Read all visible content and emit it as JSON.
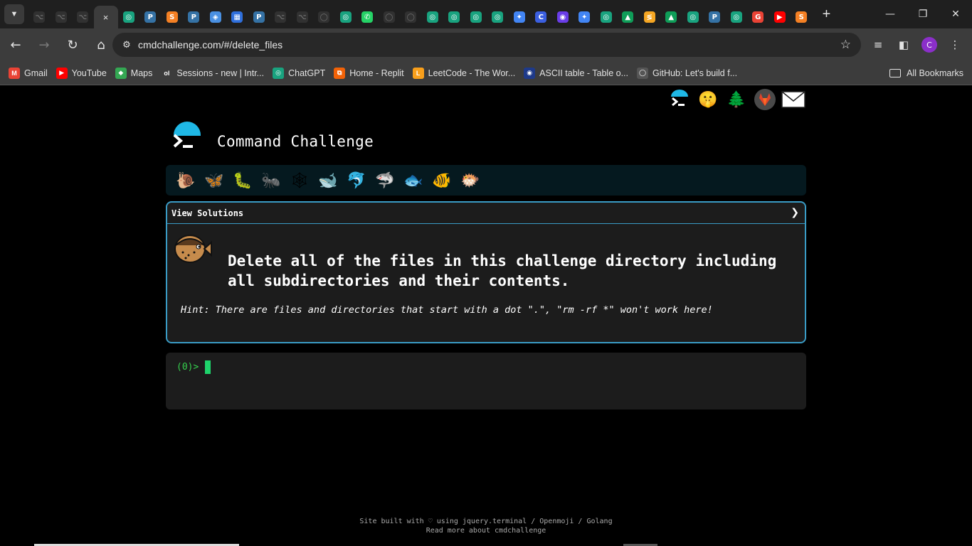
{
  "browser": {
    "url": "cmdchallenge.com/#/delete_files",
    "tabs": [
      {
        "glyph": "⌥",
        "color": "#555555",
        "dim": true
      },
      {
        "glyph": "⌥",
        "color": "#555555",
        "dim": true
      },
      {
        "glyph": "⌥",
        "color": "#555555",
        "dim": true
      },
      {
        "glyph": "×",
        "color": "#3c3c3c",
        "dim": false,
        "active": true
      },
      {
        "glyph": "◎",
        "color": "#19a37f",
        "dim": false
      },
      {
        "glyph": "P",
        "color": "#3572a5",
        "dim": false
      },
      {
        "glyph": "S",
        "color": "#f48024",
        "dim": false
      },
      {
        "glyph": "P",
        "color": "#3572a5",
        "dim": false
      },
      {
        "glyph": "◈",
        "color": "#4a90e2",
        "dim": false
      },
      {
        "glyph": "▦",
        "color": "#2f6fdb",
        "dim": false
      },
      {
        "glyph": "P",
        "color": "#3572a5",
        "dim": false
      },
      {
        "glyph": "⌥",
        "color": "#555555",
        "dim": true
      },
      {
        "glyph": "⌥",
        "color": "#555555",
        "dim": true
      },
      {
        "glyph": "◯",
        "color": "#555555",
        "dim": true
      },
      {
        "glyph": "◎",
        "color": "#19a37f",
        "dim": false
      },
      {
        "glyph": "✆",
        "color": "#25d366",
        "dim": false
      },
      {
        "glyph": "◯",
        "color": "#555555",
        "dim": true
      },
      {
        "glyph": "◯",
        "color": "#555555",
        "dim": true
      },
      {
        "glyph": "◎",
        "color": "#19a37f",
        "dim": false
      },
      {
        "glyph": "◎",
        "color": "#19a37f",
        "dim": false
      },
      {
        "glyph": "◎",
        "color": "#19a37f",
        "dim": false
      },
      {
        "glyph": "◎",
        "color": "#19a37f",
        "dim": false
      },
      {
        "glyph": "✦",
        "color": "#4285f4",
        "dim": false
      },
      {
        "glyph": "C",
        "color": "#3b5fe0",
        "dim": false
      },
      {
        "glyph": "◉",
        "color": "#6a3de8",
        "dim": false
      },
      {
        "glyph": "✦",
        "color": "#4285f4",
        "dim": false
      },
      {
        "glyph": "◎",
        "color": "#19a37f",
        "dim": false
      },
      {
        "glyph": "▲",
        "color": "#0f9d58",
        "dim": false
      },
      {
        "glyph": "≶",
        "color": "#f5a623",
        "dim": false
      },
      {
        "glyph": "▲",
        "color": "#0f9d58",
        "dim": false
      },
      {
        "glyph": "◎",
        "color": "#19a37f",
        "dim": false
      },
      {
        "glyph": "P",
        "color": "#3572a5",
        "dim": false
      },
      {
        "glyph": "◎",
        "color": "#19a37f",
        "dim": false
      },
      {
        "glyph": "G",
        "color": "#ea4335",
        "dim": false
      },
      {
        "glyph": "▶",
        "color": "#ff0000",
        "dim": false
      },
      {
        "glyph": "S",
        "color": "#f48024",
        "dim": false
      }
    ],
    "bookmarks": [
      {
        "label": "Gmail",
        "icon": "M",
        "color": "#ea4335"
      },
      {
        "label": "YouTube",
        "icon": "▶",
        "color": "#ff0000"
      },
      {
        "label": "Maps",
        "icon": "◆",
        "color": "#34a853"
      },
      {
        "label": "Sessions - new | Intr...",
        "icon": "ol",
        "color": "#3c3c3c"
      },
      {
        "label": "ChatGPT",
        "icon": "◎",
        "color": "#19a37f"
      },
      {
        "label": "Home - Replit",
        "icon": "⧉",
        "color": "#f26207"
      },
      {
        "label": "LeetCode - The Wor...",
        "icon": "L",
        "color": "#f89f1b"
      },
      {
        "label": "ASCII table - Table o...",
        "icon": "◉",
        "color": "#1e3a8a"
      },
      {
        "label": "GitHub: Let's build f...",
        "icon": "◯",
        "color": "#555555"
      }
    ],
    "all_bookmarks": "All Bookmarks",
    "profile_initial": "C"
  },
  "site": {
    "title": "Command Challenge",
    "social_icons": [
      "terminal-icon",
      "hushed-face-icon",
      "evergreen-tree-icon",
      "gitlab-icon",
      "envelope-icon"
    ],
    "levels": [
      "snail",
      "butterfly",
      "bug",
      "ant",
      "spider-web",
      "whale",
      "dolphin",
      "shark",
      "fish",
      "tropical-fish",
      "blowfish"
    ],
    "view_solutions": "View Solutions",
    "challenge": "Delete all of the files in this challenge directory including all subdirectories and their contents.",
    "hint": "Hint: There are files and directories that start with a dot \".\", \"rm -rf *\" won't work here!",
    "prompt": "(0)>",
    "footer_line1": "Site built with ♡ using jquery.terminal / Openmoji / Golang",
    "footer_line2": "Read more about cmdchallenge"
  }
}
